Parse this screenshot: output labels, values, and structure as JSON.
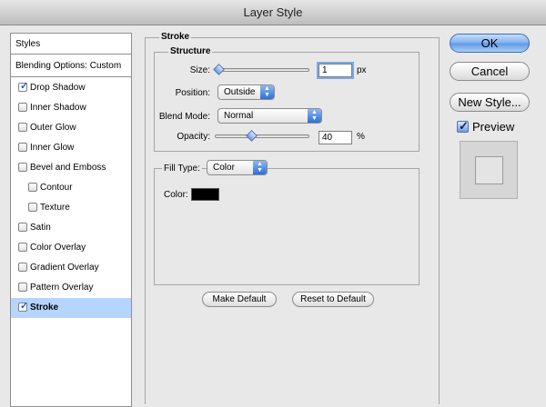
{
  "window": {
    "title": "Layer Style"
  },
  "styles_panel": {
    "header": "Styles",
    "blending_options": "Blending Options: Custom",
    "items": [
      {
        "label": "Drop Shadow",
        "checked": true,
        "indent": false,
        "selected": false
      },
      {
        "label": "Inner Shadow",
        "checked": false,
        "indent": false,
        "selected": false
      },
      {
        "label": "Outer Glow",
        "checked": false,
        "indent": false,
        "selected": false
      },
      {
        "label": "Inner Glow",
        "checked": false,
        "indent": false,
        "selected": false
      },
      {
        "label": "Bevel and Emboss",
        "checked": false,
        "indent": false,
        "selected": false
      },
      {
        "label": "Contour",
        "checked": false,
        "indent": true,
        "selected": false
      },
      {
        "label": "Texture",
        "checked": false,
        "indent": true,
        "selected": false
      },
      {
        "label": "Satin",
        "checked": false,
        "indent": false,
        "selected": false
      },
      {
        "label": "Color Overlay",
        "checked": false,
        "indent": false,
        "selected": false
      },
      {
        "label": "Gradient Overlay",
        "checked": false,
        "indent": false,
        "selected": false
      },
      {
        "label": "Pattern Overlay",
        "checked": false,
        "indent": false,
        "selected": false
      },
      {
        "label": "Stroke",
        "checked": true,
        "indent": false,
        "selected": true
      }
    ]
  },
  "stroke": {
    "group_title": "Stroke",
    "structure_title": "Structure",
    "size_label": "Size:",
    "size_value": "1",
    "size_unit": "px",
    "position_label": "Position:",
    "position_value": "Outside",
    "blend_mode_label": "Blend Mode:",
    "blend_mode_value": "Normal",
    "opacity_label": "Opacity:",
    "opacity_value": "40",
    "opacity_unit": "%",
    "fill_type_label": "Fill Type:",
    "fill_type_value": "Color",
    "color_label": "Color:",
    "color_hex": "#000000",
    "make_default": "Make Default",
    "reset_default": "Reset to Default"
  },
  "actions": {
    "ok": "OK",
    "cancel": "Cancel",
    "new_style": "New Style...",
    "preview_label": "Preview",
    "preview_checked": true
  },
  "colors": {
    "selection": "#b5d5ff",
    "accent": "#5e98e6",
    "check": "#1f5ec8"
  }
}
